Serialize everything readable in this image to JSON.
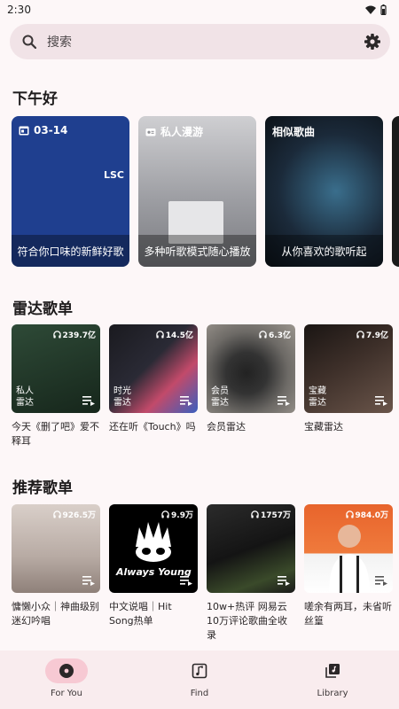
{
  "status": {
    "time": "2:30"
  },
  "search": {
    "placeholder": "搜索"
  },
  "greeting": "下午好",
  "featured": [
    {
      "head": "03-14",
      "foot": "符合你口味的新鲜好歌",
      "icon": "calendar-icon"
    },
    {
      "head": "私人漫游",
      "foot": "多种听歌模式随心播放",
      "icon": "radio-icon"
    },
    {
      "head": "相似歌曲",
      "foot": "从你喜欢的歌听起",
      "icon": ""
    }
  ],
  "radar": {
    "title": "雷达歌单",
    "items": [
      {
        "plays": "239.7亿",
        "overlay": "私人\n雷达",
        "title": "今天《删了吧》爱不释耳"
      },
      {
        "plays": "14.5亿",
        "overlay": "时光\n雷达",
        "title": "还在听《Touch》吗"
      },
      {
        "plays": "6.3亿",
        "overlay": "会员\n雷达",
        "title": "会员雷达"
      },
      {
        "plays": "7.9亿",
        "overlay": "宝藏\n雷达",
        "title": "宝藏雷达"
      }
    ]
  },
  "recommend": {
    "title": "推荐歌单",
    "items": [
      {
        "plays": "926.5万",
        "title": "慵懒小众｜神曲级别迷幻吟唱"
      },
      {
        "plays": "9.9万",
        "title": "中文说唱｜Hit Song热单"
      },
      {
        "plays": "1757万",
        "title": "10w+热评 网易云10万评论歌曲全收录"
      },
      {
        "plays": "984.0万",
        "title": "嗟余有两耳，未省听丝篁"
      }
    ]
  },
  "nav": [
    {
      "label": "For You",
      "active": true
    },
    {
      "label": "Find",
      "active": false
    },
    {
      "label": "Library",
      "active": false
    }
  ],
  "colors": {
    "accent_pill": "#f7c9d3",
    "background": "#fdf7f8",
    "search_bg": "#f1e3e7"
  }
}
